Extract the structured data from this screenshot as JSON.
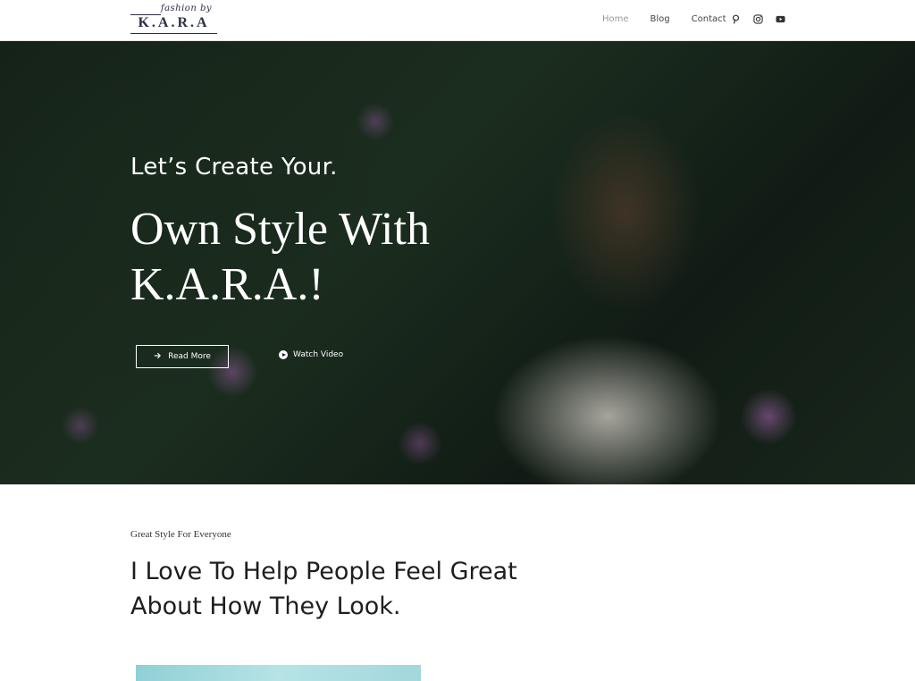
{
  "header": {
    "logo": {
      "script": "fashion by",
      "main": "K.A.R.A"
    },
    "nav": [
      {
        "label": "Home",
        "active": true
      },
      {
        "label": "Blog",
        "active": false
      },
      {
        "label": "Contact",
        "active": false
      }
    ],
    "social_icons": [
      "pinterest-icon",
      "instagram-icon",
      "youtube-icon"
    ]
  },
  "hero": {
    "subtitle": "Let’s Create Your.",
    "title_line1": "Own Style With",
    "title_line2": "K.A.R.A.!",
    "read_more_label": "Read More",
    "watch_video_label": "Watch Video"
  },
  "section": {
    "eyebrow": "Great Style For Everyone",
    "heading_line1": "I Love To Help People Feel Great",
    "heading_line2": "About How They Look."
  },
  "colors": {
    "logo": "#2b2f4a",
    "nav_active": "#9a9a9a",
    "preview_accent": "#a2d7dc"
  }
}
